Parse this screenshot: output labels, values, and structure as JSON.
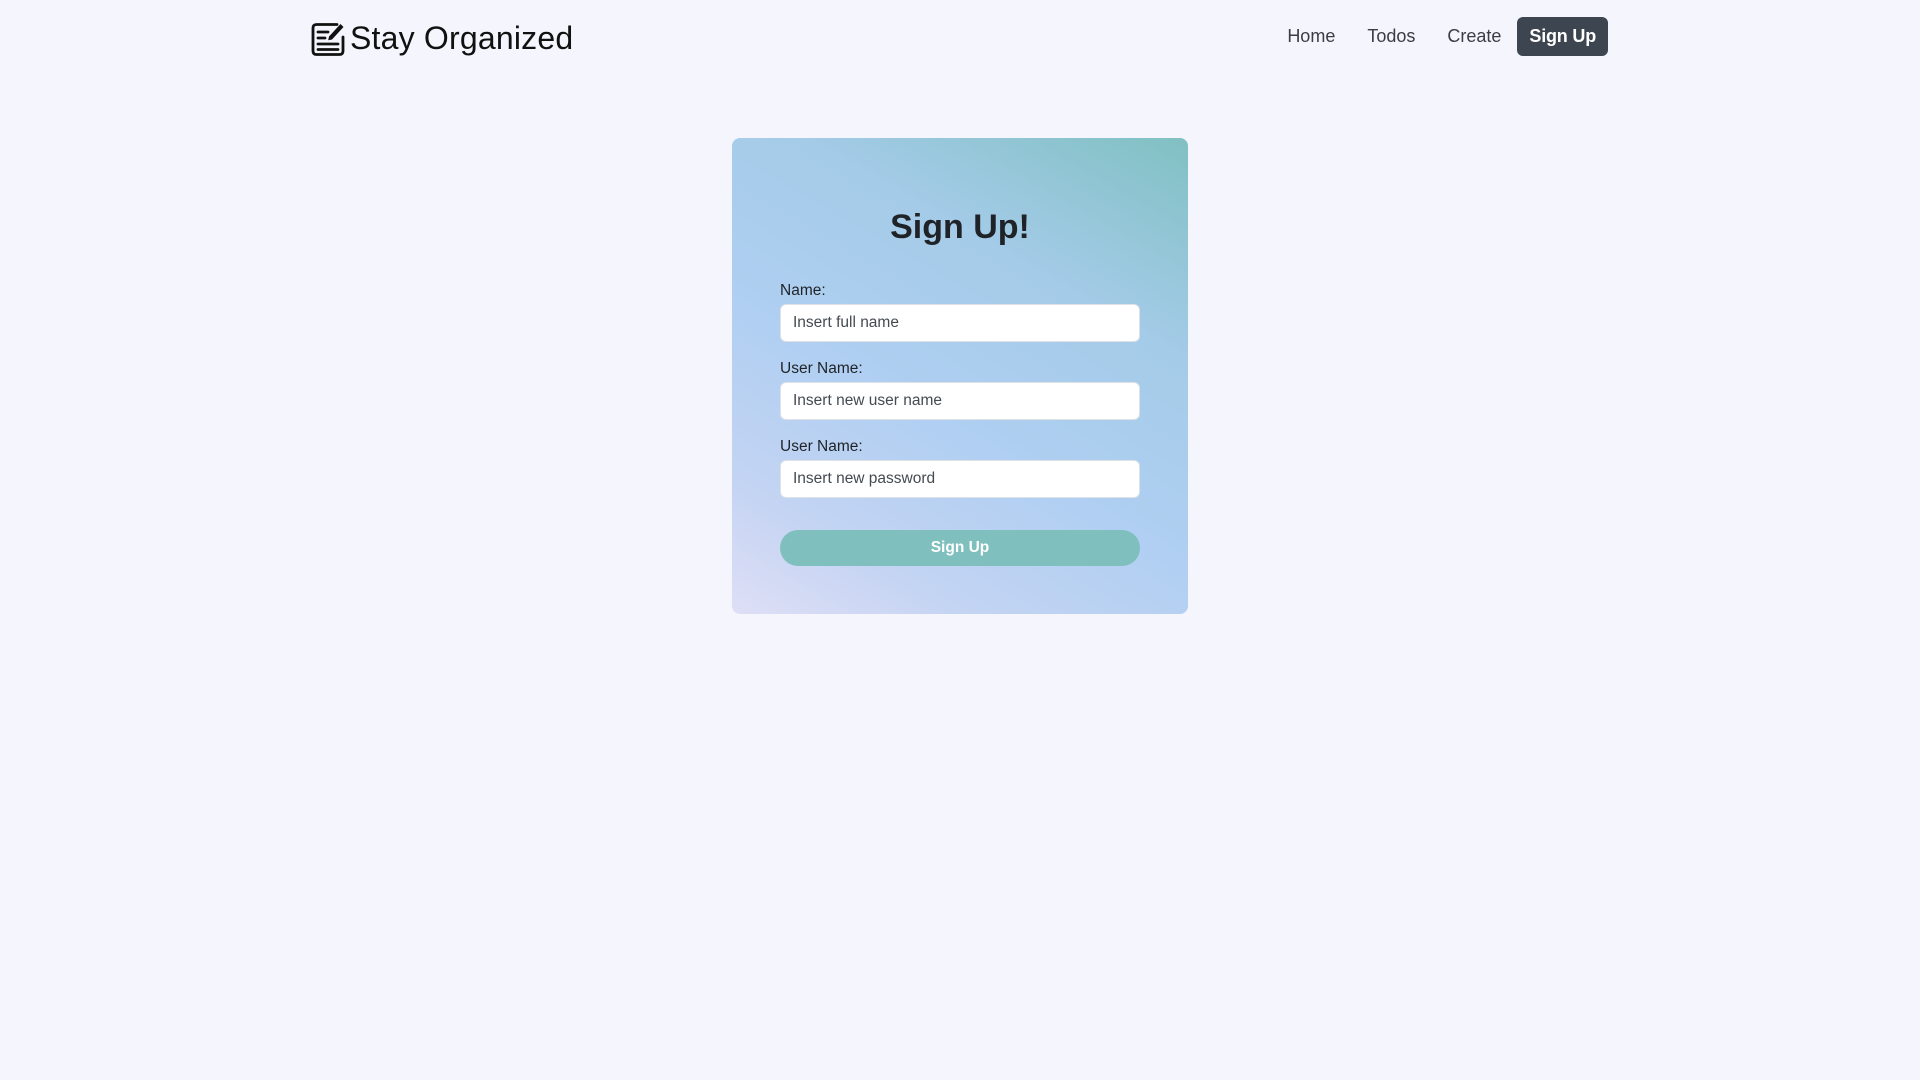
{
  "navbar": {
    "brand_icon": "note-edit-icon",
    "brand_text": "Stay Organized",
    "links": [
      {
        "label": "Home"
      },
      {
        "label": "Todos"
      },
      {
        "label": "Create"
      }
    ],
    "cta_label": "Sign Up"
  },
  "form": {
    "title": "Sign Up!",
    "fields": [
      {
        "label": "Name:",
        "placeholder": "Insert full name",
        "value": ""
      },
      {
        "label": "User Name:",
        "placeholder": "Insert new user name",
        "value": ""
      },
      {
        "label": "User Name:",
        "placeholder": "Insert new password",
        "value": ""
      }
    ],
    "submit_label": "Sign Up"
  },
  "colors": {
    "background": "#f5f5fd",
    "nav_cta": "#3d4650",
    "submit_button": "#7fbfbd",
    "card_gradient": [
      "#80c0c2",
      "#b0cff2",
      "#dfdff6"
    ]
  }
}
